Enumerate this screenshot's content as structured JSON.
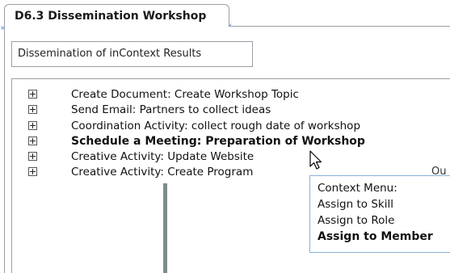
{
  "tab": {
    "label": "D6.3 Dissemination Workshop"
  },
  "title_field": {
    "value": "Dissemination of inContext Results"
  },
  "tree": {
    "items": [
      {
        "label": "Create Document: Create Workshop Topic",
        "bold": false
      },
      {
        "label": "Send Email: Partners to collect ideas",
        "bold": false
      },
      {
        "label": "Coordination Activity: collect rough date of workshop",
        "bold": false
      },
      {
        "label": "Schedule a Meeting:  Preparation of Workshop",
        "bold": true
      },
      {
        "label": "Creative Activity: Update Website",
        "bold": false
      },
      {
        "label": "Creative Activity: Create Program",
        "bold": false
      }
    ],
    "truncated_text": "Ou"
  },
  "context_menu": {
    "items": [
      {
        "label": "Context Menu:",
        "bold": false
      },
      {
        "label": "Assign to Skill",
        "bold": false
      },
      {
        "label": "Assign to Role",
        "bold": false
      },
      {
        "label": "Assign to Member",
        "bold": true
      }
    ]
  },
  "icons": {
    "expander": "plus-box-icon",
    "marker": "x-marker-icon",
    "cursor": "arrow-cursor-icon"
  },
  "colors": {
    "marker": "#4a7de0",
    "border": "#9aa0a6",
    "menu_border": "#8ab0d6",
    "pointer_line": "#7f8c8d"
  }
}
